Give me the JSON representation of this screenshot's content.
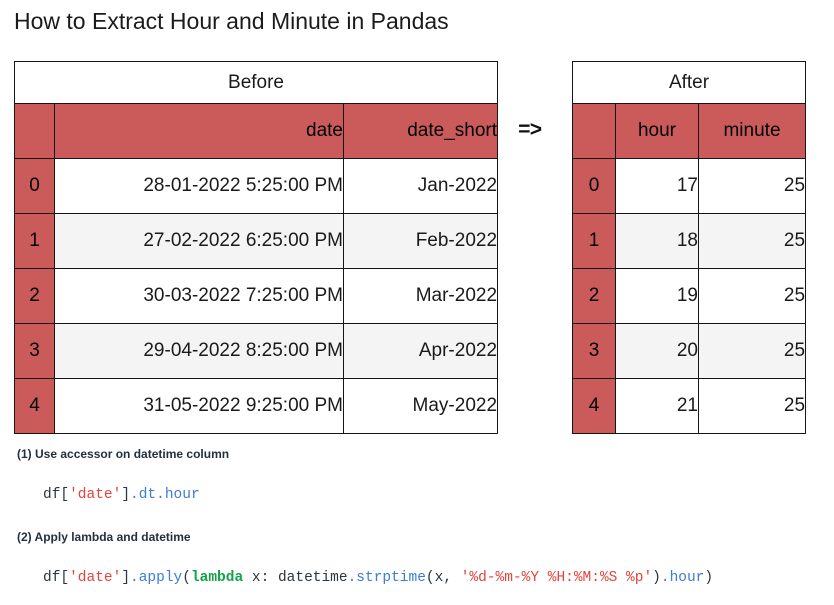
{
  "title": "How to Extract Hour and Minute in Pandas",
  "arrow": "=>",
  "colors": {
    "header_red": "#cb5b5b",
    "row_alt": "#f4f4f4",
    "string_token": "#e8413a",
    "attribute_token": "#3b7dd8",
    "keyword_token": "#12a34a"
  },
  "before_table": {
    "caption": "Before",
    "columns": [
      "",
      "date",
      "date_short"
    ],
    "rows": [
      {
        "index": "0",
        "date": "28-01-2022 5:25:00 PM",
        "date_short": "Jan-2022"
      },
      {
        "index": "1",
        "date": "27-02-2022 6:25:00 PM",
        "date_short": "Feb-2022"
      },
      {
        "index": "2",
        "date": "30-03-2022 7:25:00 PM",
        "date_short": "Mar-2022"
      },
      {
        "index": "3",
        "date": "29-04-2022 8:25:00 PM",
        "date_short": "Apr-2022"
      },
      {
        "index": "4",
        "date": "31-05-2022 9:25:00 PM",
        "date_short": "May-2022"
      }
    ]
  },
  "after_table": {
    "caption": "After",
    "columns": [
      "",
      "hour",
      "minute"
    ],
    "rows": [
      {
        "index": "0",
        "hour": "17",
        "minute": "25"
      },
      {
        "index": "1",
        "hour": "18",
        "minute": "25"
      },
      {
        "index": "2",
        "hour": "19",
        "minute": "25"
      },
      {
        "index": "3",
        "hour": "20",
        "minute": "25"
      },
      {
        "index": "4",
        "hour": "21",
        "minute": "25"
      }
    ]
  },
  "snippets": [
    {
      "label": "(1) Use accessor on datetime column",
      "code_plain": "df['date'].dt.hour",
      "tokens": [
        {
          "text": "df[",
          "type": "plain"
        },
        {
          "text": "'date'",
          "type": "str"
        },
        {
          "text": "]",
          "type": "plain"
        },
        {
          "text": ".dt.hour",
          "type": "attr"
        }
      ]
    },
    {
      "label": "(2) Apply lambda and datetime",
      "code_plain": "df['date'].apply(lambda x: datetime.strptime(x, '%d-%m-%Y %H:%M:%S %p').hour)",
      "tokens": [
        {
          "text": "df[",
          "type": "plain"
        },
        {
          "text": "'date'",
          "type": "str"
        },
        {
          "text": "]",
          "type": "plain"
        },
        {
          "text": ".apply",
          "type": "attr"
        },
        {
          "text": "(",
          "type": "plain"
        },
        {
          "text": "lambda",
          "type": "kw"
        },
        {
          "text": " x: datetime",
          "type": "plain"
        },
        {
          "text": ".strptime",
          "type": "attr"
        },
        {
          "text": "(x, ",
          "type": "plain"
        },
        {
          "text": "'%d-%m-%Y %H:%M:%S %p'",
          "type": "str"
        },
        {
          "text": ")",
          "type": "plain"
        },
        {
          "text": ".hour",
          "type": "attr"
        },
        {
          "text": ")",
          "type": "plain"
        }
      ]
    }
  ]
}
